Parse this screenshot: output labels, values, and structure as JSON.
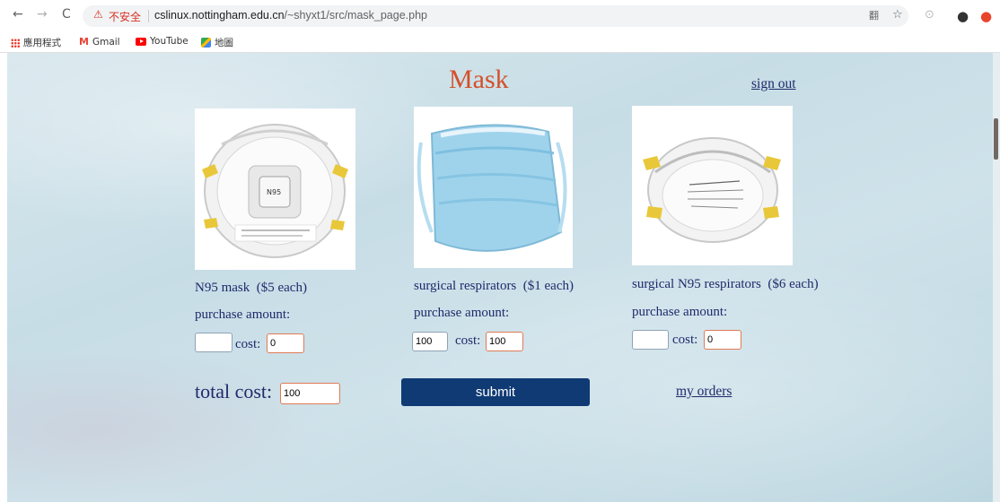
{
  "browser": {
    "nav": {
      "back": "←",
      "forward": "→",
      "reload": "C"
    },
    "security_icon": "⚠",
    "security_label": "不安全",
    "url_host": "cslinux.nottingham.edu.cn",
    "url_path": "/~shyxt1/src/mask_page.php",
    "tools": {
      "translate": "翻",
      "bookmark_star": "☆",
      "profile": "●",
      "extension": "⊙"
    }
  },
  "bookmarks": [
    {
      "label": "應用程式",
      "icon": "apps-icon"
    },
    {
      "label": "Gmail",
      "icon": "gmail-icon"
    },
    {
      "label": "YouTube",
      "icon": "youtube-icon"
    },
    {
      "label": "地圖",
      "icon": "maps-icon"
    }
  ],
  "page": {
    "title": "Mask",
    "sign_out": "sign out",
    "products": [
      {
        "name": "N95 mask  ($5 each)",
        "purchase_label": "purchase amount:",
        "qty": "",
        "cost_label": "cost:",
        "cost": "0"
      },
      {
        "name": "surgical respirators  ($1 each)",
        "purchase_label": "purchase amount:",
        "qty": "100",
        "cost_label": "cost:",
        "cost": "100"
      },
      {
        "name": "surgical N95 respirators  ($6 each)",
        "purchase_label": "purchase amount:",
        "qty": "",
        "cost_label": "cost:",
        "cost": "0"
      }
    ],
    "total_label": "total cost:",
    "total_value": "100",
    "submit_label": "submit",
    "my_orders": "my orders"
  }
}
